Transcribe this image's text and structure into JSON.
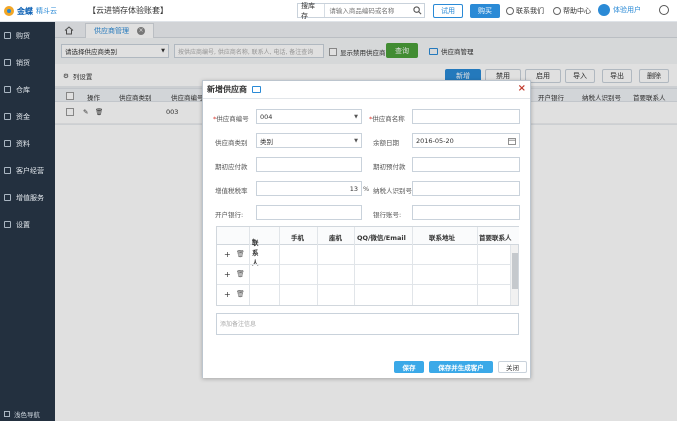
{
  "top": {
    "brand": "金蝶",
    "brand_sub": "精斗云",
    "app_title": "【云进销存体验账套】",
    "search_scope": "搜库存",
    "search_placeholder": "请输入商品编码或名称",
    "try_label": "试用",
    "buy_label": "购买",
    "contact_label": "联系我们",
    "help_label": "帮助中心",
    "user_label": "体验用户"
  },
  "sidebar": {
    "items": [
      {
        "label": "购货",
        "icon": "cart-icon"
      },
      {
        "label": "销货",
        "icon": "sales-icon"
      },
      {
        "label": "仓库",
        "icon": "warehouse-icon"
      },
      {
        "label": "资金",
        "icon": "money-icon"
      },
      {
        "label": "资料",
        "icon": "data-icon"
      },
      {
        "label": "客户经营",
        "icon": "customer-icon"
      },
      {
        "label": "增值服务",
        "icon": "service-icon"
      },
      {
        "label": "设置",
        "icon": "settings-icon"
      }
    ],
    "bottom_label": "浅色导航"
  },
  "tabs": {
    "active": "供应商管理"
  },
  "filter": {
    "category_select": "请选择供应商类别",
    "keyword_placeholder": "按供应商编号, 供应商名称, 联系人, 电话, 备注查询",
    "show_disabled": "显示禁用供应商",
    "query_label": "查询",
    "video_label": "供应商管理"
  },
  "toolbar": {
    "col_settings": "列设置",
    "buttons": [
      "新增",
      "禁用",
      "启用",
      "导入",
      "导出",
      "删除"
    ]
  },
  "table": {
    "headers": [
      "操作",
      "供应商类别",
      "供应商编号",
      "开户银行",
      "纳税人识别号",
      "首要联系人"
    ],
    "rows": [
      {
        "code": "003"
      }
    ]
  },
  "modal": {
    "title": "新增供应商",
    "close": "×",
    "fields": {
      "code_label": "供应商编号",
      "code_value": "004",
      "name_label": "供应商名称",
      "name_value": "",
      "category_label": "供应商类别",
      "category_value": "类别",
      "balance_date_label": "余额日期",
      "balance_date_value": "2016-05-20",
      "payable_label": "期初应付款",
      "prepaid_label": "期初预付款",
      "tax_rate_label": "增值税税率",
      "tax_rate_value": "13",
      "tax_rate_unit": "%",
      "taxpayer_label": "纳税人识别号:",
      "bank_label": "开户银行:",
      "account_label": "银行账号:"
    },
    "grid": {
      "headers": [
        "联系人",
        "手机",
        "座机",
        "QQ/微信/Email",
        "联系地址",
        "首要联系人"
      ],
      "row_count": 3,
      "plus": "+",
      "trash": "🗑"
    },
    "note_placeholder": "添加备注信息",
    "buttons": {
      "save": "保存",
      "save_new": "保存并生成客户",
      "close": "关闭"
    }
  }
}
